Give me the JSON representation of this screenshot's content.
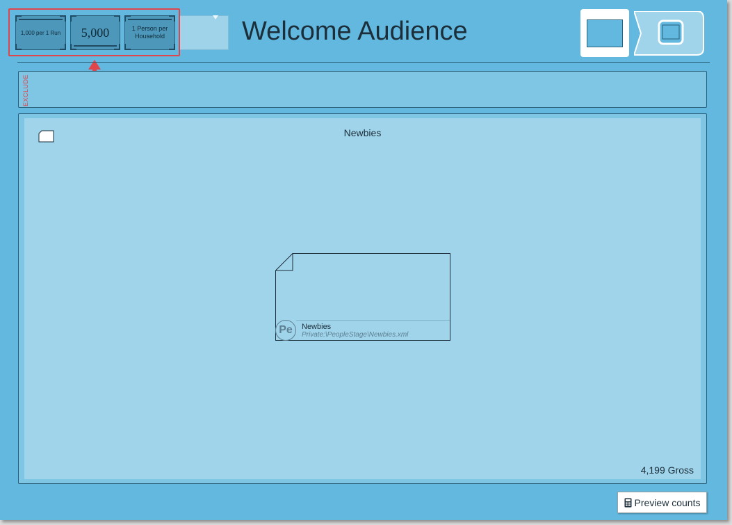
{
  "header": {
    "title": "Welcome Audience",
    "limits": {
      "per_run": "1,000 per 1 Run",
      "count": "5,000",
      "per_household": "1 Person per Household"
    }
  },
  "exclude": {
    "label": "EXCLUDE"
  },
  "main": {
    "title": "Newbies",
    "node": {
      "badge": "Pe",
      "name": "Newbies",
      "path": "Private:\\PeopleStage\\Newbies.xml"
    },
    "gross_count": "4,199",
    "gross_label": "Gross"
  },
  "footer": {
    "preview_label": "Preview counts"
  },
  "colors": {
    "canvas": "#62b8df",
    "panel": "#a0d4ea",
    "highlight": "#e0454b",
    "arrow": "#e0454b"
  }
}
